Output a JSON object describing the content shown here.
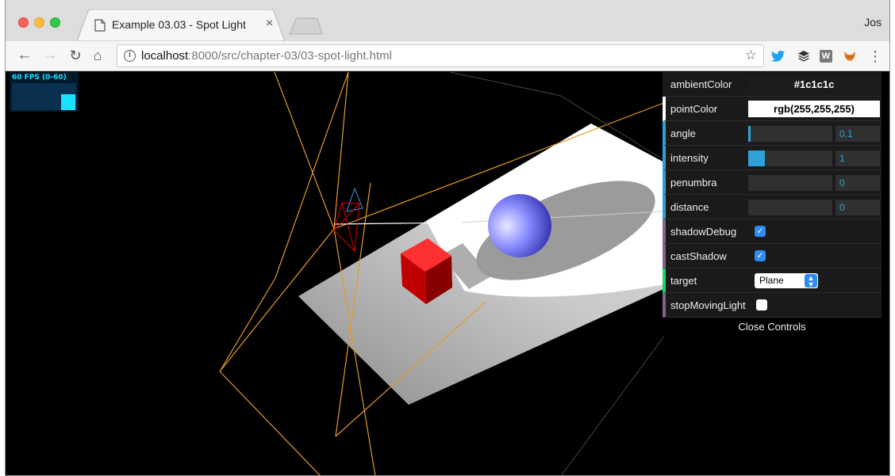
{
  "browser": {
    "tab_title": "Example 03.03 - Spot Light",
    "tab_close": "×",
    "profile_name": "Jos",
    "url_host": "localhost",
    "url_rest": ":8000/src/chapter-03/03-spot-light.html",
    "info_glyph": "i",
    "star_glyph": "☆",
    "menu_glyph": "⋮",
    "w_ext_label": "W"
  },
  "stats": {
    "label": "60 FPS (0-60)"
  },
  "gui": {
    "ambientColor": {
      "label": "ambientColor",
      "value": "#1c1c1c"
    },
    "pointColor": {
      "label": "pointColor",
      "value": "rgb(255,255,255)"
    },
    "angle": {
      "label": "angle",
      "value": "0.1",
      "fraction": 0.02
    },
    "intensity": {
      "label": "intensity",
      "value": "1",
      "fraction": 0.2
    },
    "penumbra": {
      "label": "penumbra",
      "value": "0",
      "fraction": 0
    },
    "distance": {
      "label": "distance",
      "value": "0",
      "fraction": 0
    },
    "shadowDebug": {
      "label": "shadowDebug",
      "checked": true
    },
    "castShadow": {
      "label": "castShadow",
      "checked": true
    },
    "target": {
      "label": "target",
      "value": "Plane"
    },
    "stopMovingLight": {
      "label": "stopMovingLight",
      "checked": false
    },
    "close_label": "Close Controls"
  },
  "colors": {
    "slider_accent": "#2fa1d6",
    "checkbox_blue": "#2e8cf0",
    "frustum_orange": "#e39a2a",
    "cube_red": "#e00000",
    "sphere_blue": "#8a8cff"
  }
}
